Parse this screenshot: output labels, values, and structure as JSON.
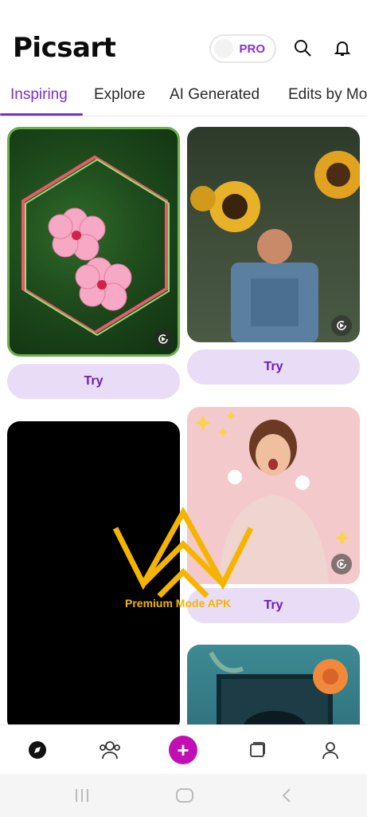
{
  "app": {
    "name": "Picsart"
  },
  "header": {
    "pro_label": "PRO"
  },
  "tabs": [
    {
      "label": "Inspiring",
      "active": true
    },
    {
      "label": "Explore"
    },
    {
      "label": "AI Generated"
    },
    {
      "label": "Edits by Mo"
    }
  ],
  "feed": {
    "try_label": "Try",
    "cards": [
      {
        "name": "flower-template",
        "has_play": true
      },
      {
        "name": "sunflower-template",
        "has_play": true
      },
      {
        "name": "black-template"
      },
      {
        "name": "surprised-woman-template",
        "has_play": true
      },
      {
        "name": "floral-frame-template"
      }
    ]
  },
  "watermark": {
    "text": "Premium Mode APK"
  },
  "bottom_nav": {
    "items": [
      "discover-icon",
      "community-icon",
      "create-icon",
      "projects-icon",
      "profile-icon"
    ]
  },
  "colors": {
    "accent": "#7b2fc9",
    "create": "#c10fb5",
    "try_bg": "#e8dcf7"
  }
}
